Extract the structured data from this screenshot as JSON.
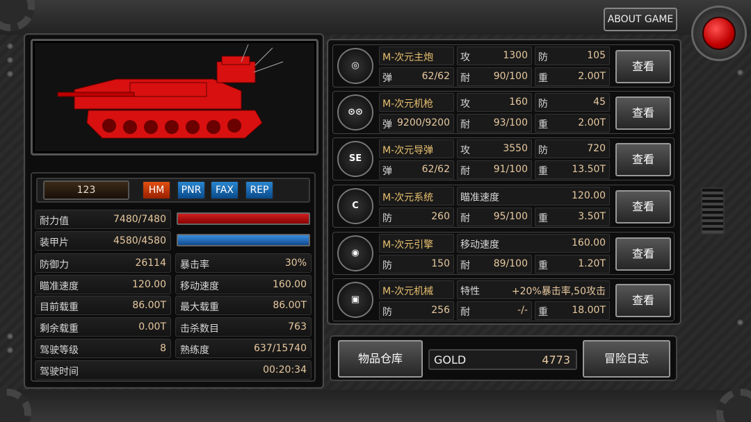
{
  "top": {
    "about_label": "ABOUT GAME"
  },
  "tank": {
    "id_value": "123",
    "tags": [
      "HM",
      "PNR",
      "FAX",
      "REP"
    ],
    "color": "#e01010"
  },
  "stats": {
    "durability_label": "耐力值",
    "durability_value": "7480/7480",
    "armor_label": "装甲片",
    "armor_value": "4580/4580",
    "defense_label": "防御力",
    "defense_value": "26114",
    "crit_label": "暴击率",
    "crit_value": "30%",
    "aim_label": "瞄准速度",
    "aim_value": "120.00",
    "move_label": "移动速度",
    "move_value": "160.00",
    "load_label": "目前载重",
    "load_value": "86.00T",
    "maxload_label": "最大载重",
    "maxload_value": "86.00T",
    "remain_label": "剩余载重",
    "remain_value": "0.00T",
    "kills_label": "击杀数目",
    "kills_value": "763",
    "level_label": "驾驶等级",
    "level_value": "8",
    "skill_label": "熟练度",
    "skill_value": "637/15740",
    "time_label": "驾驶时间",
    "time_value": "00:20:34"
  },
  "equipment": [
    {
      "icon": "◎",
      "name": "M-次元主炮",
      "a_label": "攻",
      "a_value": "1300",
      "b_label": "防",
      "b_value": "105",
      "c_label": "弹",
      "c_value": "62/62",
      "d_label": "耐",
      "d_value": "90/100",
      "e_label": "重",
      "e_value": "2.00T",
      "btn": "查看"
    },
    {
      "icon": "⊙⊙",
      "name": "M-次元机枪",
      "a_label": "攻",
      "a_value": "160",
      "b_label": "防",
      "b_value": "45",
      "c_label": "弹",
      "c_value": "9200/9200",
      "d_label": "耐",
      "d_value": "93/100",
      "e_label": "重",
      "e_value": "2.00T",
      "btn": "查看"
    },
    {
      "icon": "SE",
      "name": "M-次元导弹",
      "a_label": "攻",
      "a_value": "3550",
      "b_label": "防",
      "b_value": "720",
      "c_label": "弹",
      "c_value": "62/62",
      "d_label": "耐",
      "d_value": "91/100",
      "e_label": "重",
      "e_value": "13.50T",
      "btn": "查看"
    },
    {
      "icon": "C",
      "name": "M-次元系统",
      "a_label": "瞄准速度",
      "a_value": "120.00",
      "c_label": "防",
      "c_value": "260",
      "d_label": "耐",
      "d_value": "95/100",
      "e_label": "重",
      "e_value": "3.50T",
      "btn": "查看"
    },
    {
      "icon": "◉",
      "name": "M-次元引擎",
      "a_label": "移动速度",
      "a_value": "160.00",
      "c_label": "防",
      "c_value": "150",
      "d_label": "耐",
      "d_value": "89/100",
      "e_label": "重",
      "e_value": "1.20T",
      "btn": "查看"
    },
    {
      "icon": "▣",
      "name": "M-次元机械",
      "a_label": "特性",
      "a_value": "+20%暴击率,50攻击",
      "c_label": "防",
      "c_value": "256",
      "d_label": "耐",
      "d_value": "-/-",
      "e_label": "重",
      "e_value": "18.00T",
      "btn": "查看"
    }
  ],
  "bottom": {
    "warehouse_label": "物品仓库",
    "gold_label": "GOLD",
    "gold_value": "4773",
    "log_label": "冒险日志"
  }
}
